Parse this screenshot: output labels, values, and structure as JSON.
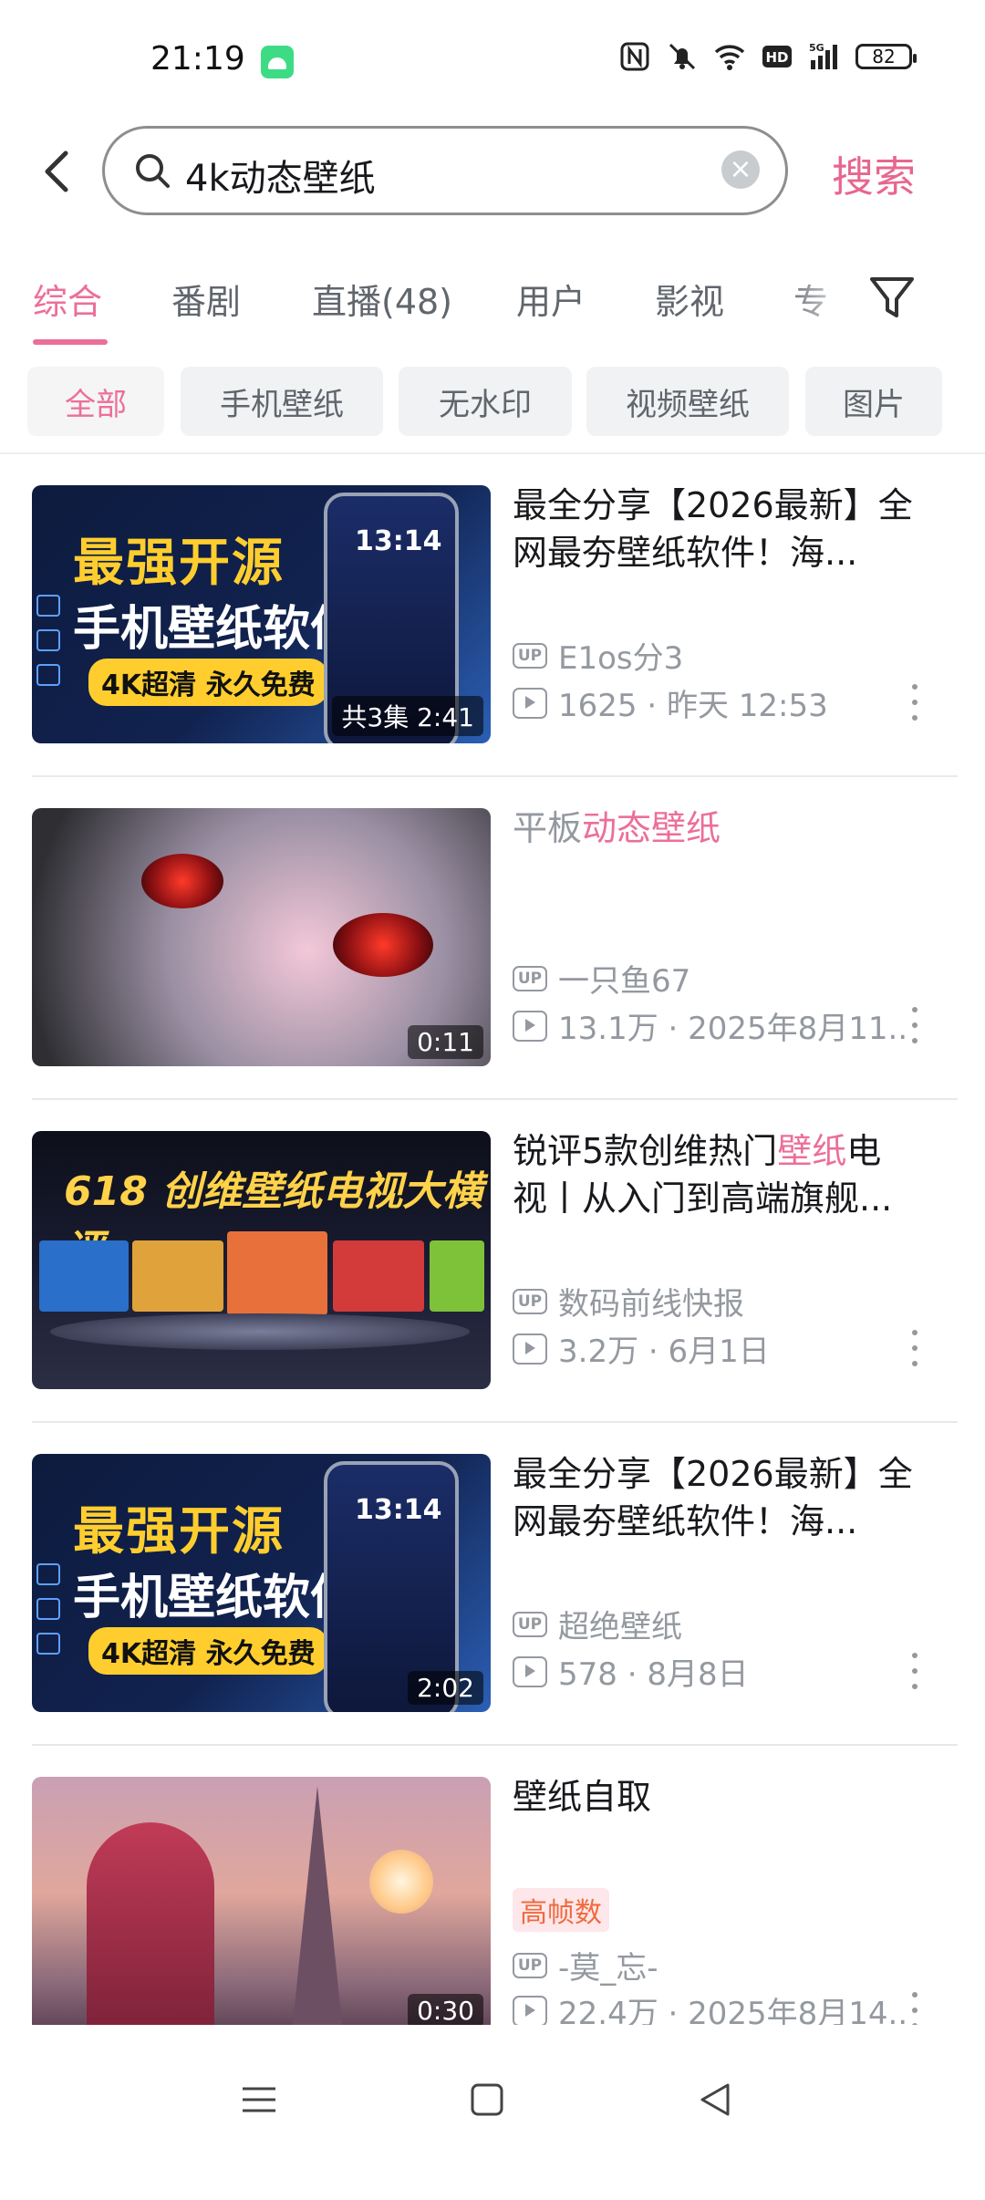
{
  "status_bar": {
    "time": "21:19",
    "battery": "82"
  },
  "search": {
    "query": "4k动态壁纸",
    "submit_label": "搜索"
  },
  "tabs": [
    "综合",
    "番剧",
    "直播(48)",
    "用户",
    "影视",
    "专"
  ],
  "chips": [
    "全部",
    "手机壁纸",
    "无水印",
    "视频壁纸",
    "图片"
  ],
  "results": [
    {
      "title": "最全分享【2026最新】全网最夯壁纸软件！海...",
      "thumb_line1": "最强开源",
      "thumb_line2": "手机壁纸软件",
      "thumb_line3": "4K超清 永久免费",
      "thumb_phone_time": "13:14",
      "duration": "共3集 2:41",
      "uploader": "E1os分3",
      "plays_date": "1625 · 昨天 12:53"
    },
    {
      "title_prefix": "平板",
      "title_highlight": "动态壁纸",
      "duration": "0:11",
      "uploader": "一只鱼67",
      "plays_date": "13.1万 · 2025年8月11..."
    },
    {
      "title_line1_prefix": "锐评5款创维热门",
      "title_highlight": "壁纸",
      "title_line1_suffix": "电",
      "title_line2": "视丨从入门到高端旗舰...",
      "thumb_title": "618 创维壁纸电视大横评",
      "uploader": "数码前线快报",
      "plays_date": "3.2万 · 6月1日"
    },
    {
      "title": "最全分享【2026最新】全网最夯壁纸软件！海...",
      "thumb_line1": "最强开源",
      "thumb_line2": "手机壁纸软件",
      "thumb_line3": "4K超清 永久免费",
      "thumb_phone_time": "13:14",
      "duration": "2:02",
      "uploader": "超绝壁纸",
      "plays_date": "578 · 8月8日"
    },
    {
      "title": "壁纸自取",
      "badge": "高帧数",
      "duration": "0:30",
      "uploader": "-莫_忘-",
      "plays_date": "22.4万 · 2025年8月14..."
    }
  ],
  "labels": {
    "up": "UP"
  },
  "colors": {
    "accent": "#ec6f98",
    "meta_gray": "#9499a0",
    "badge_text": "#f06a3d"
  }
}
